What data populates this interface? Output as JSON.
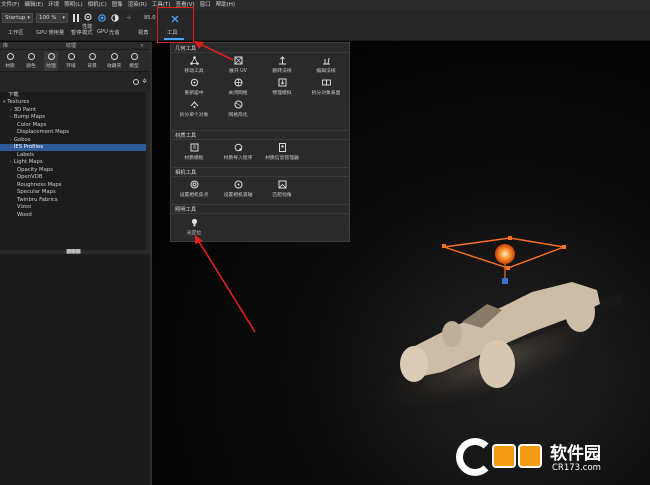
{
  "menu": [
    "文件(F)",
    "编辑(E)",
    "环境",
    "照明(L)",
    "相机(C)",
    "图像",
    "渲染(R)",
    "工具(T)",
    "查看(V)",
    "窗口",
    "帮助(H)"
  ],
  "toolbar": {
    "workspace": "Startup",
    "resolution": "100 %",
    "workspace_label": "工作区",
    "gpu_usage_label": "GPU 使用量",
    "pause_label": "暂停",
    "perf_line1": "性能",
    "perf_line2": "模式",
    "gpu_label": "GPU",
    "render_label": "光追",
    "fov_value": "85.0",
    "view_angle_label": "视角",
    "tools_label": "工具"
  },
  "panel": {
    "tab_library": "库",
    "tab_texture": "纹理",
    "categories": [
      "材质",
      "颜色",
      "纹理",
      "环境",
      "背景",
      "收藏夹",
      "模型"
    ],
    "tree": [
      "下载",
      "Textures",
      "3D Paint",
      "Bump Maps",
      "Color Maps",
      "Displacement Maps",
      "Gobos",
      "IES Profiles",
      "Labels",
      "Light Maps",
      "Opacity Maps",
      "OpenVDB",
      "Roughness Maps",
      "Specular Maps",
      "Twinbru Fabrics",
      "Vizoo",
      "Wood"
    ]
  },
  "popup": {
    "sections": [
      "几何工具",
      "材质工具",
      "相机工具",
      "照明工具"
    ],
    "tools": [
      "移动工具",
      "展开 UV",
      "翻转法线",
      "编辑法线",
      "重新居中",
      "关闭网格",
      "物理模拟",
      "拆分对象表面",
      "拆分单个对象",
      "网格简化",
      "材质模板",
      "材质导入程序",
      "材质信息管理器",
      "设置相机焦点",
      "设置相机滚轴",
      "匹配视角",
      "光定位"
    ]
  },
  "watermark": {
    "brand": "软件园",
    "url": "CR173.com"
  },
  "colors": {
    "accent": "#4aa3ff",
    "selection": "#2e5a97",
    "annotation": "#e02020",
    "gizmo": "#ff7020"
  }
}
